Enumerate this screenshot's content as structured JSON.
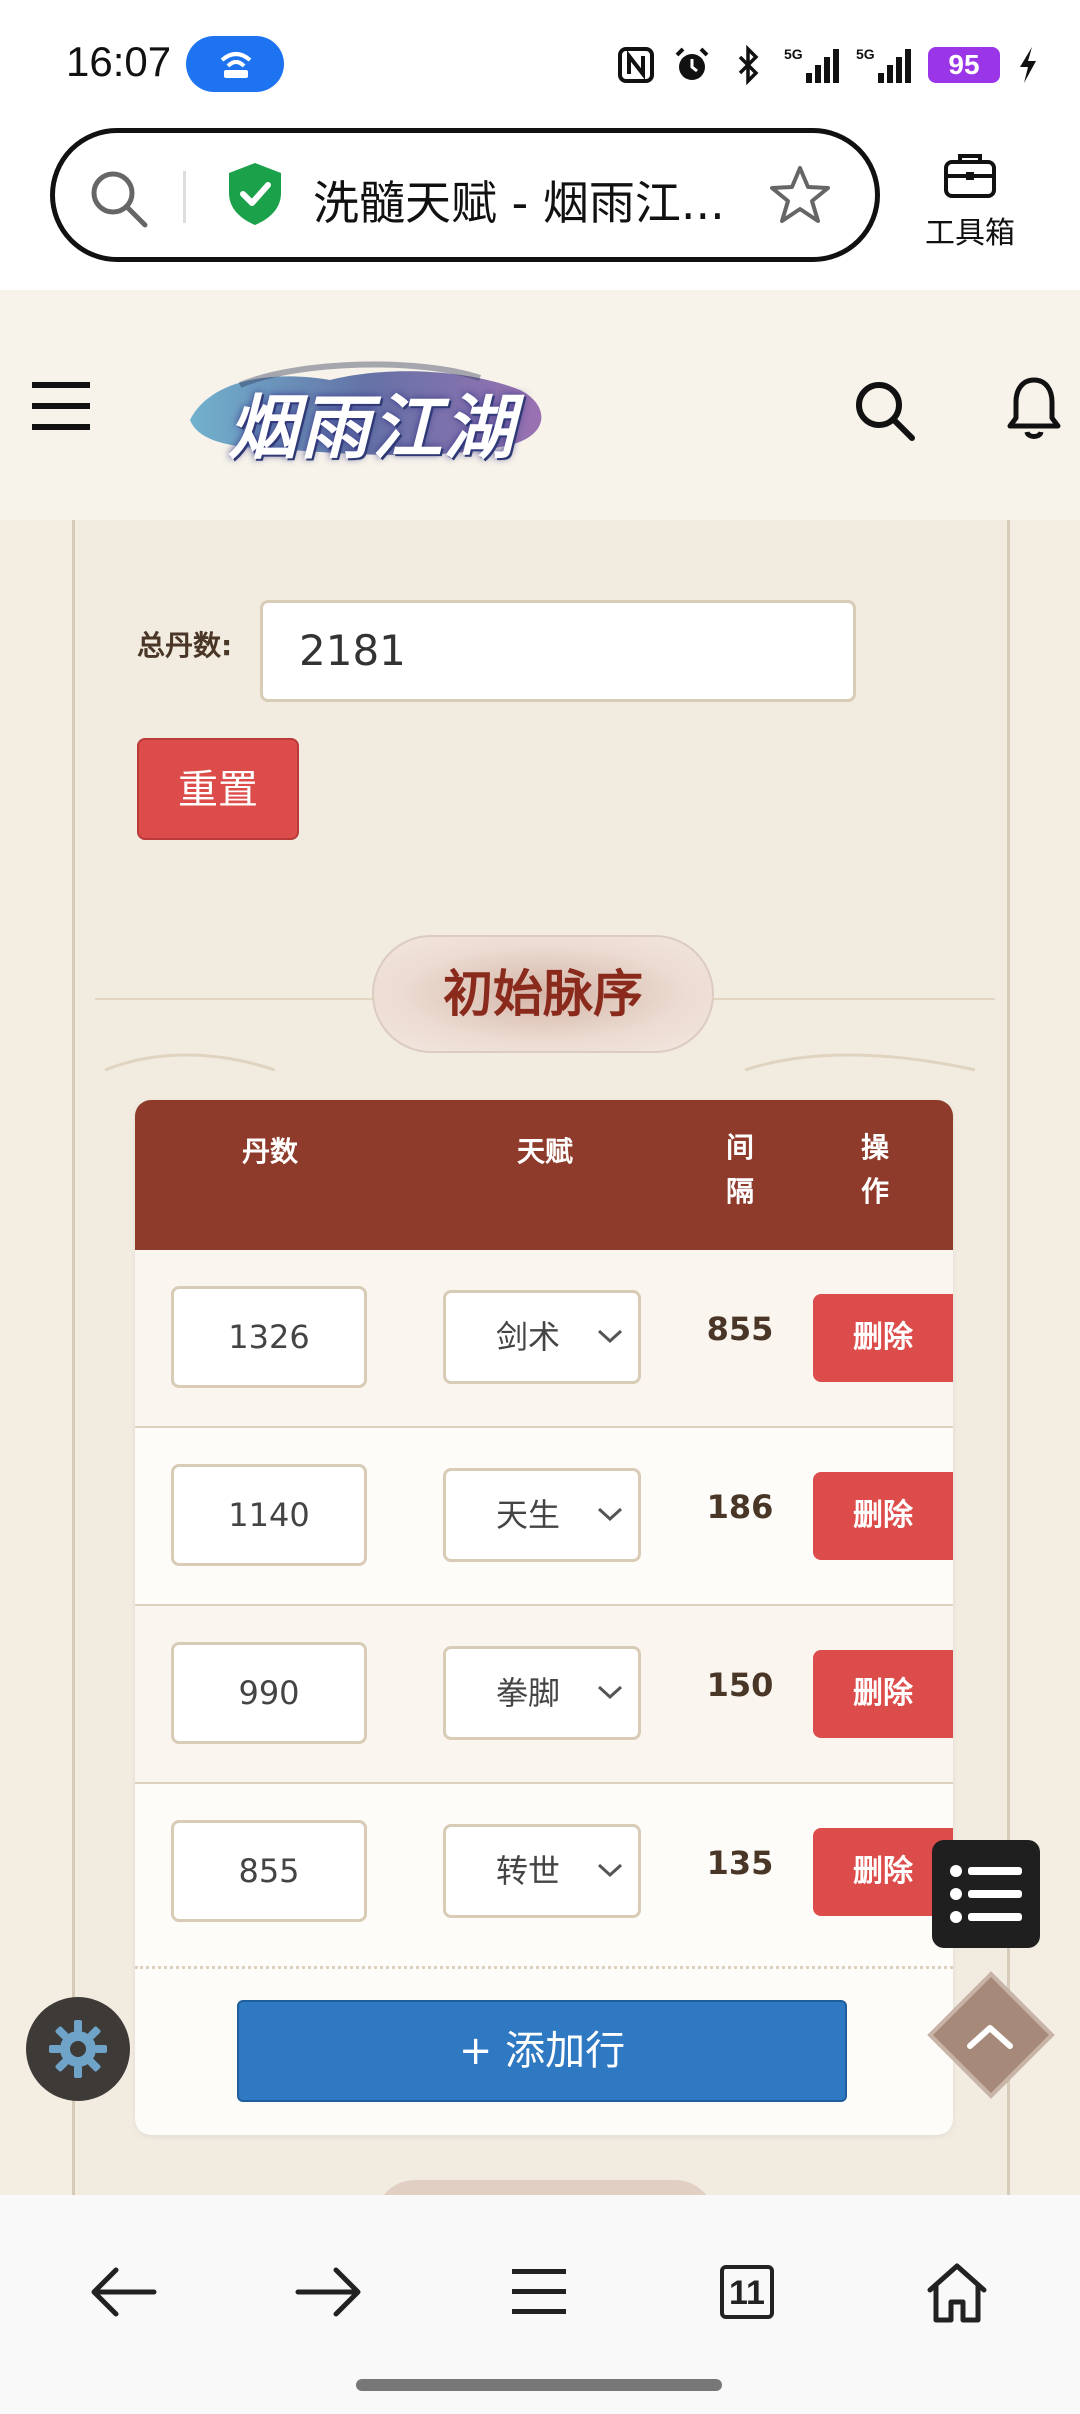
{
  "status_bar": {
    "time": "16:07",
    "battery": "95",
    "signal_1": "5G",
    "signal_2": "5G"
  },
  "browser": {
    "tab_title": "洗髓天赋 - 烟雨江...",
    "toolbox_label": "工具箱",
    "tab_count": "11"
  },
  "site": {
    "logo_text": "烟雨江湖"
  },
  "form": {
    "total_label": "总丹数:",
    "total_value": "2181",
    "reset_label": "重置"
  },
  "section": {
    "title": "初始脉序"
  },
  "table": {
    "headers": {
      "dan": "丹数",
      "talent": "天赋",
      "gap": "间隔",
      "op": "操作"
    },
    "rows": [
      {
        "dan": "1326",
        "talent": "剑术",
        "gap": "855",
        "action": "删除"
      },
      {
        "dan": "1140",
        "talent": "天生",
        "gap": "186",
        "action": "删除"
      },
      {
        "dan": "990",
        "talent": "拳脚",
        "gap": "150",
        "action": "删除"
      },
      {
        "dan": "855",
        "talent": "转世",
        "gap": "135",
        "action": "删除"
      }
    ],
    "add_row_label": "+ 添加行"
  },
  "colors": {
    "header_bg": "#8e3b2b",
    "delete_btn": "#dc4c4a",
    "add_btn": "#2f79c2",
    "battery": "#9b35e8",
    "hotspot": "#1e74f0"
  }
}
